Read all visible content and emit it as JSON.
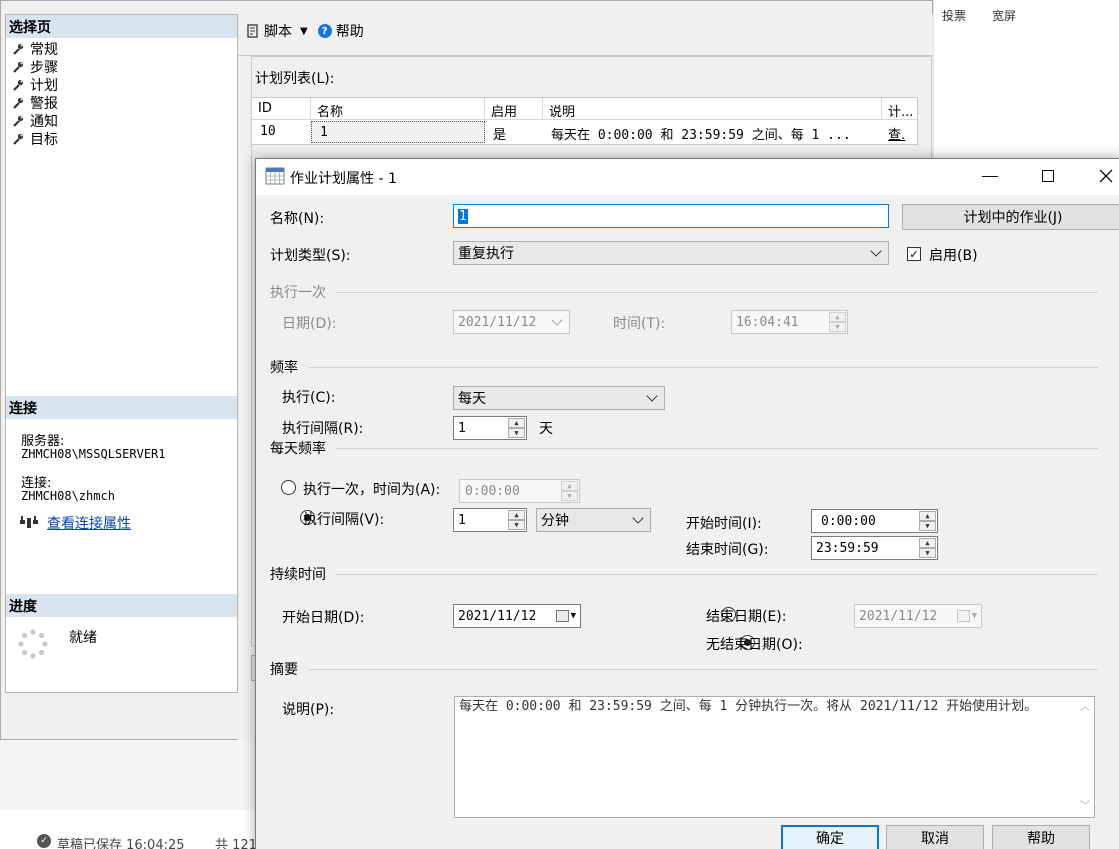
{
  "background": {
    "right_menu": [
      "投票",
      "宽屏"
    ],
    "status": "草稿已保存 16:04:25",
    "status_count": "共 121"
  },
  "job_window": {
    "select_page_header": "选择页",
    "nav_items": [
      "常规",
      "步骤",
      "计划",
      "警报",
      "通知",
      "目标"
    ],
    "connection_header": "连接",
    "server_label": "服务器:",
    "server_value": "ZHMCH08\\MSSQLSERVER1",
    "connection_label": "连接:",
    "connection_value": "ZHMCH08\\zhmch",
    "view_connection_link": "查看连接属性",
    "progress_header": "进度",
    "progress_status": "就绪",
    "toolbar": {
      "script": "脚本",
      "help": "帮助"
    },
    "schedule_list_label": "计划列表(L):",
    "table": {
      "columns": [
        "ID",
        "名称",
        "启用",
        "说明",
        "计..."
      ],
      "rows": [
        {
          "id": "10",
          "name": "1",
          "enabled": "是",
          "desc": "每天在 0:00:00 和 23:59:59 之间、每 1 ...",
          "link": "查."
        }
      ]
    }
  },
  "dialog": {
    "title": "作业计划属性 - 1",
    "name_label": "名称(N):",
    "name_value": "1",
    "jobs_in_schedule_button": "计划中的作业(J)",
    "schedule_type_label": "计划类型(S):",
    "schedule_type_value": "重复执行",
    "enabled_label": "启用(B)",
    "enabled_checked": true,
    "one_time": {
      "group": "执行一次",
      "date_label": "日期(D):",
      "date_value": "2021/11/12",
      "time_label": "时间(T):",
      "time_value": "16:04:41"
    },
    "frequency": {
      "group": "频率",
      "occurs_label": "执行(C):",
      "occurs_value": "每天",
      "recurs_label": "执行间隔(R):",
      "recurs_value": "1",
      "recurs_unit": "天"
    },
    "daily_frequency": {
      "group": "每天频率",
      "once_label": "执行一次，时间为(A):",
      "once_value": "0:00:00",
      "every_label": "执行间隔(V):",
      "every_value": "1",
      "every_unit": "分钟",
      "start_label": "开始时间(I):",
      "start_value": "0:00:00",
      "end_label": "结束时间(G):",
      "end_value": "23:59:59"
    },
    "duration": {
      "group": "持续时间",
      "start_label": "开始日期(D):",
      "start_value": "2021/11/12",
      "end_date_label": "结束日期(E):",
      "end_date_value": "2021/11/12",
      "no_end_label": "无结束日期(O):"
    },
    "summary": {
      "group": "摘要",
      "desc_label": "说明(P):",
      "desc_value": "每天在 0:00:00 和 23:59:59 之间、每 1 分钟执行一次。将从 2021/11/12 开始使用计划。"
    },
    "buttons": {
      "ok": "确定",
      "cancel": "取消",
      "help": "帮助"
    }
  }
}
